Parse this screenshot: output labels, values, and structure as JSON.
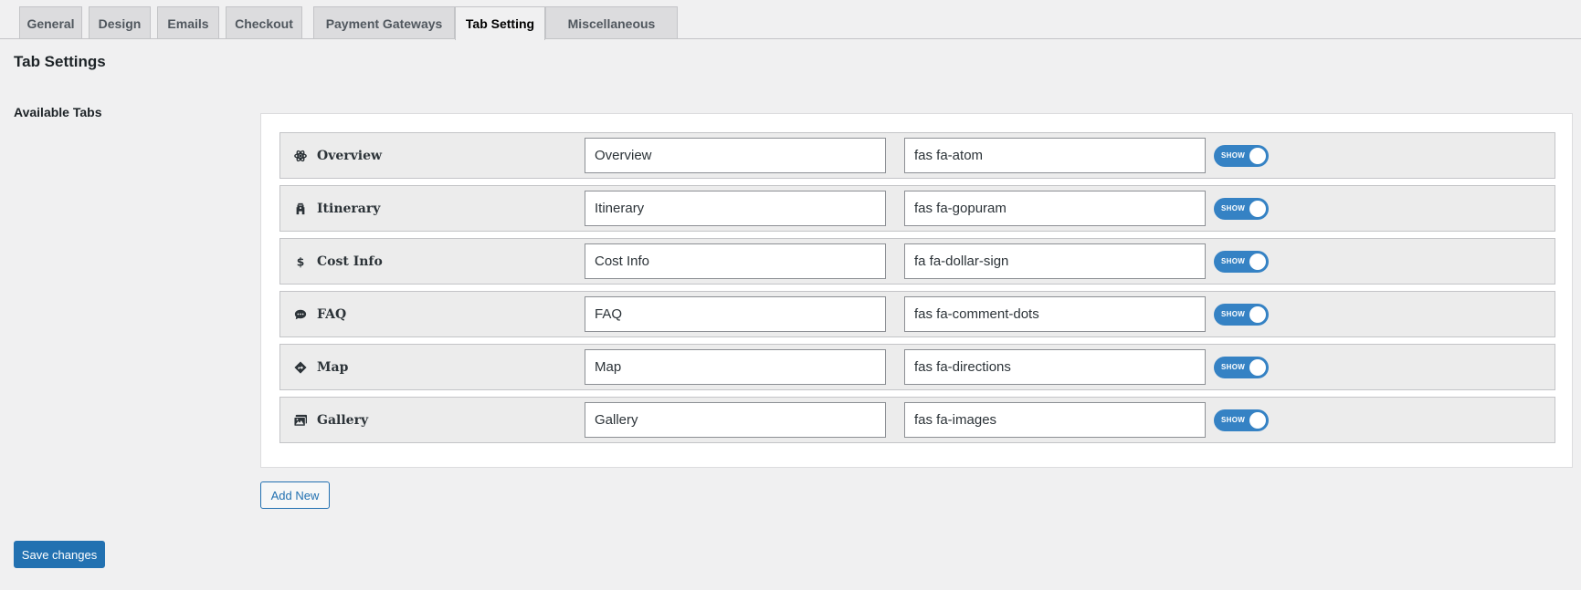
{
  "nav": {
    "tabs": [
      {
        "label": "General"
      },
      {
        "label": "Design"
      },
      {
        "label": "Emails"
      },
      {
        "label": "Checkout"
      },
      {
        "label": "Payment Gateways"
      },
      {
        "label": "Tab Setting",
        "active": true
      },
      {
        "label": "Miscellaneous"
      }
    ]
  },
  "page": {
    "title": "Tab Settings",
    "field_label": "Available Tabs"
  },
  "tab_rows": [
    {
      "name": "Overview",
      "icon": "atom-icon",
      "label_value": "Overview",
      "icon_value": "fas fa-atom",
      "toggle": "SHOW"
    },
    {
      "name": "Itinerary",
      "icon": "gopuram-icon",
      "label_value": "Itinerary",
      "icon_value": "fas fa-gopuram",
      "toggle": "SHOW"
    },
    {
      "name": "Cost Info",
      "icon": "dollar-sign-icon",
      "label_value": "Cost Info",
      "icon_value": "fa fa-dollar-sign",
      "toggle": "SHOW"
    },
    {
      "name": "FAQ",
      "icon": "comment-dots-icon",
      "label_value": "FAQ",
      "icon_value": "fas fa-comment-dots",
      "toggle": "SHOW"
    },
    {
      "name": "Map",
      "icon": "directions-icon",
      "label_value": "Map",
      "icon_value": "fas fa-directions",
      "toggle": "SHOW"
    },
    {
      "name": "Gallery",
      "icon": "images-icon",
      "label_value": "Gallery",
      "icon_value": "fas fa-images",
      "toggle": "SHOW"
    }
  ],
  "buttons": {
    "add_new": "Add New",
    "save": "Save changes"
  },
  "colors": {
    "accent": "#2271b1",
    "toggle_on": "#3582c4",
    "background": "#f0f0f1"
  }
}
